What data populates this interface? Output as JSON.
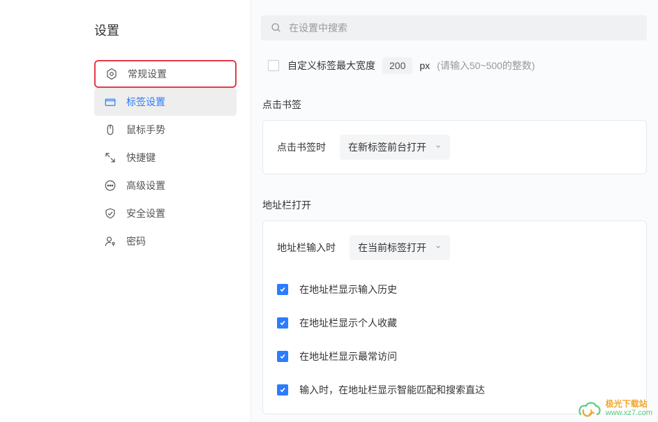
{
  "page": {
    "title": "设置"
  },
  "search": {
    "placeholder": "在设置中搜索"
  },
  "sidebar": {
    "items": [
      {
        "label": "常规设置"
      },
      {
        "label": "标签设置"
      },
      {
        "label": "鼠标手势"
      },
      {
        "label": "快捷键"
      },
      {
        "label": "高级设置"
      },
      {
        "label": "安全设置"
      },
      {
        "label": "密码"
      }
    ]
  },
  "maxWidth": {
    "label": "自定义标签最大宽度",
    "value": "200",
    "unit": "px",
    "hint": "(请输入50~500的整数)"
  },
  "bookmarkClick": {
    "section": "点击书签",
    "rowLabel": "点击书签时",
    "selected": "在新标签前台打开"
  },
  "addressBar": {
    "section": "地址栏打开",
    "rowLabel": "地址栏输入时",
    "selected": "在当前标签打开",
    "options": [
      {
        "label": "在地址栏显示输入历史",
        "checked": true
      },
      {
        "label": "在地址栏显示个人收藏",
        "checked": true
      },
      {
        "label": "在地址栏显示最常访问",
        "checked": true
      },
      {
        "label": "输入时，在地址栏显示智能匹配和搜索直达",
        "checked": true
      }
    ]
  },
  "watermark": {
    "title": "极光下载站",
    "url": "www.xz7.com"
  }
}
